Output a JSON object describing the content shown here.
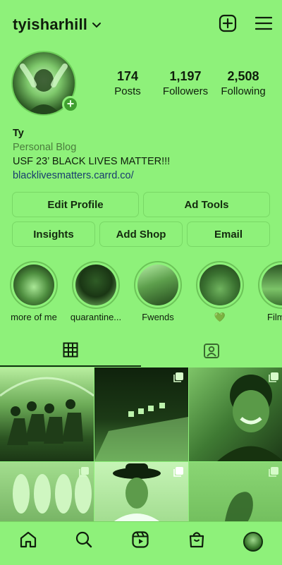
{
  "header": {
    "username": "tyisharhill"
  },
  "stats": [
    {
      "value": "174",
      "label": "Posts"
    },
    {
      "value": "1,197",
      "label": "Followers"
    },
    {
      "value": "2,508",
      "label": "Following"
    }
  ],
  "bio": {
    "name": "Ty",
    "category": "Personal Blog",
    "text": "USF 23’ BLACK LIVES MATTER!!!",
    "link": "blacklivesmatters.carrd.co/"
  },
  "buttons": {
    "edit_profile": "Edit Profile",
    "ad_tools": "Ad Tools",
    "insights": "Insights",
    "add_shop": "Add Shop",
    "email": "Email"
  },
  "highlights": [
    {
      "label": "more of me"
    },
    {
      "label": "quarantine..."
    },
    {
      "label": "Fwends"
    },
    {
      "label": "💚"
    },
    {
      "label": "Film ca"
    }
  ],
  "colors": {
    "background": "#8ef17a",
    "text": "#0f1f0c",
    "link": "#183c6e",
    "category": "#4a7e3d"
  },
  "icons": {
    "header": [
      "chevron-down-icon",
      "new-post-icon",
      "menu-icon"
    ],
    "tabs": [
      "grid-icon",
      "tagged-icon"
    ],
    "nav": [
      "home-icon",
      "search-icon",
      "reels-icon",
      "shop-icon",
      "profile-avatar"
    ]
  }
}
